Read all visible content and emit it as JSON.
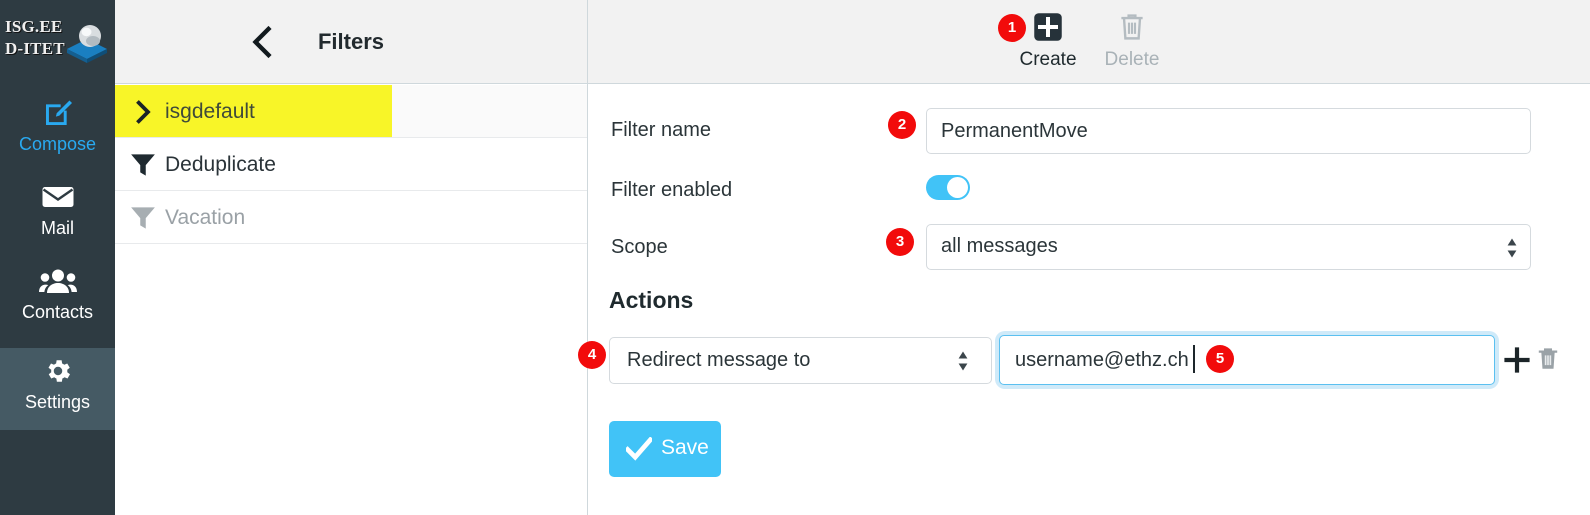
{
  "app": {
    "logo_line1": "ISG.EE",
    "logo_line2": "D-ITET"
  },
  "rail": {
    "items": [
      {
        "label": "Compose",
        "icon": "compose-pencil-icon"
      },
      {
        "label": "Mail",
        "icon": "envelope-icon"
      },
      {
        "label": "Contacts",
        "icon": "contacts-people-icon"
      },
      {
        "label": "Settings",
        "icon": "gear-icon"
      }
    ],
    "active": "Settings",
    "accent_color": "#29a9f0",
    "background_color": "#2e3b42",
    "active_background_color": "#455a64"
  },
  "filters_panel": {
    "title": "Filters",
    "back_icon": "chevron-left-icon",
    "menu_icon": "kebab-menu-icon",
    "rows": [
      {
        "label": "isgdefault",
        "icon": "chevron-right-icon",
        "highlighted": true,
        "highlight_color": "#f8f528",
        "disabled": false
      },
      {
        "label": "Deduplicate",
        "icon": "filter-funnel-icon",
        "highlighted": false,
        "disabled": false
      },
      {
        "label": "Vacation",
        "icon": "filter-funnel-icon",
        "highlighted": false,
        "disabled": true
      }
    ]
  },
  "toolbar": {
    "create_label": "Create",
    "create_icon": "plus-square-icon",
    "delete_label": "Delete",
    "delete_icon": "trash-icon",
    "delete_disabled": true
  },
  "form": {
    "filter_name_label": "Filter name",
    "filter_name_value": "PermanentMove",
    "filter_enabled_label": "Filter enabled",
    "filter_enabled_on": true,
    "scope_label": "Scope",
    "scope_value": "all messages",
    "actions_heading": "Actions",
    "action_type_value": "Redirect message to",
    "action_target_value": "username@ethz.ch",
    "action_target_focused": true,
    "add_action_icon": "plus-icon",
    "remove_action_icon": "trash-icon",
    "save_label": "Save",
    "save_icon": "check-icon",
    "save_color": "#41c3f7"
  },
  "badges": {
    "color": "#f20b0b",
    "items": [
      {
        "number": "1",
        "target": "create-button"
      },
      {
        "number": "2",
        "target": "filter-name-input"
      },
      {
        "number": "3",
        "target": "scope-select"
      },
      {
        "number": "4",
        "target": "action-type-select"
      },
      {
        "number": "5",
        "target": "action-target-input"
      }
    ]
  }
}
